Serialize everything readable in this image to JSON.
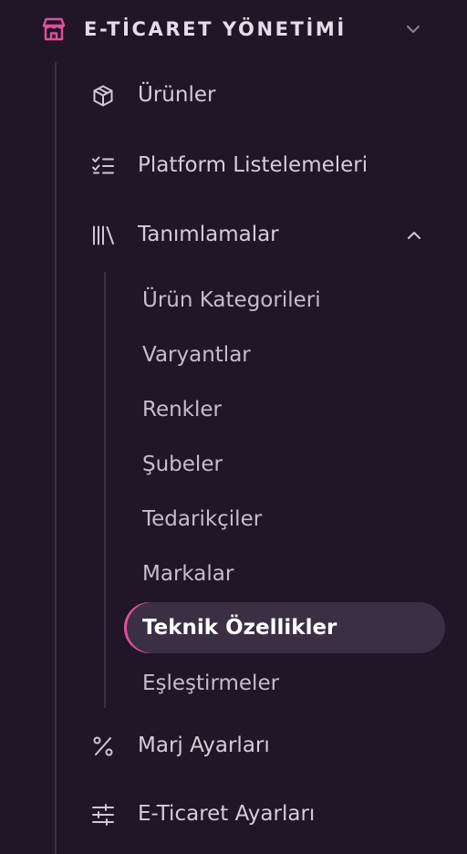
{
  "colors": {
    "background": "#201627",
    "accent": "#e0509a",
    "active_bg": "#3a2f43",
    "text": "#d3cdd9",
    "text_active": "#ffffff"
  },
  "section": {
    "title": "E-TİCARET YÖNETİMİ",
    "icon": "store-icon",
    "expanded": true
  },
  "nav": {
    "urunler": {
      "label": "Ürünler",
      "icon": "cube-icon"
    },
    "platform": {
      "label": "Platform Listelemeleri",
      "icon": "checklist-icon"
    },
    "tanimlamalar": {
      "label": "Tanımlamalar",
      "icon": "library-icon",
      "expanded": true,
      "children": [
        {
          "label": "Ürün Kategorileri",
          "active": false
        },
        {
          "label": "Varyantlar",
          "active": false
        },
        {
          "label": "Renkler",
          "active": false
        },
        {
          "label": "Şubeler",
          "active": false
        },
        {
          "label": "Tedarikçiler",
          "active": false
        },
        {
          "label": "Markalar",
          "active": false
        },
        {
          "label": "Teknik Özellikler",
          "active": true
        },
        {
          "label": "Eşleştirmeler",
          "active": false
        }
      ]
    },
    "marj": {
      "label": "Marj Ayarları",
      "icon": "percent-icon"
    },
    "eticaret": {
      "label": "E-Ticaret Ayarları",
      "icon": "sliders-icon"
    }
  }
}
